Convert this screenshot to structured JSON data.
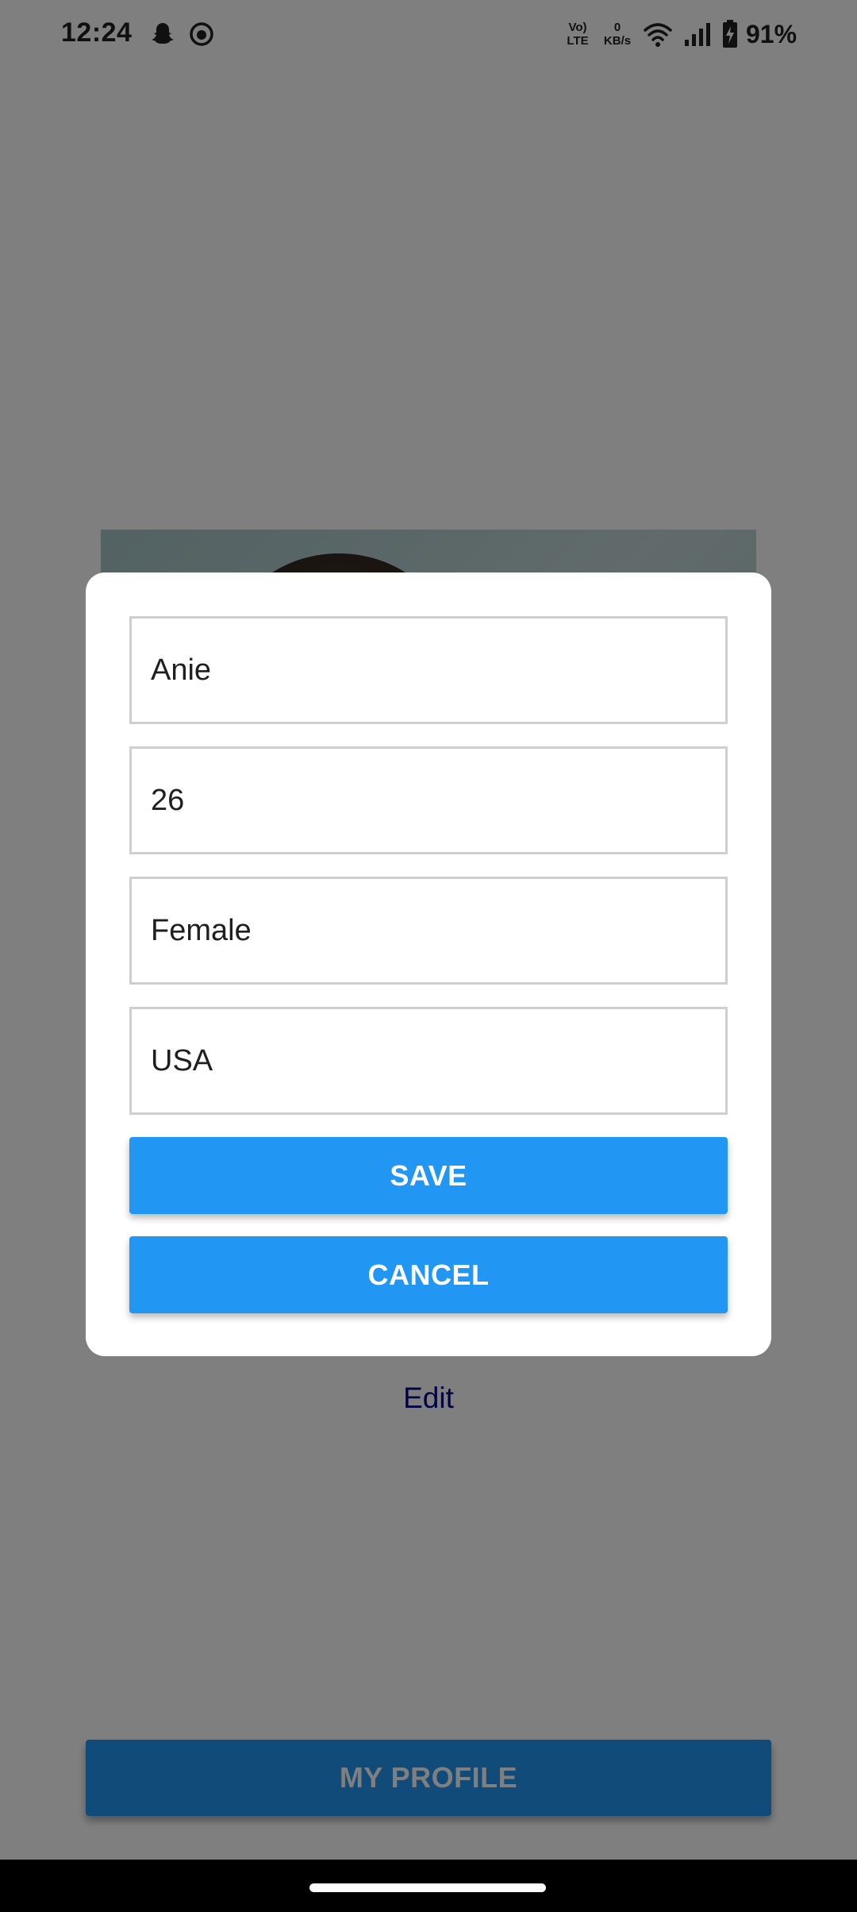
{
  "status_bar": {
    "time": "12:24",
    "volte_top": "Vo)",
    "volte_bottom": "LTE",
    "speed_top": "0",
    "speed_bottom": "KB/s",
    "battery": "91%",
    "icons": [
      "snapchat-icon",
      "notification-app-icon",
      "wifi-icon",
      "signal-icon",
      "battery-charging-icon"
    ]
  },
  "screen": {
    "edit_link": "Edit",
    "my_profile_button": "MY PROFILE"
  },
  "dialog": {
    "fields": {
      "name": "Anie",
      "age": "26",
      "gender": "Female",
      "country": "USA"
    },
    "save_label": "SAVE",
    "cancel_label": "CANCEL"
  },
  "colors": {
    "button_blue": "#2196f3",
    "link_blue": "#00008b",
    "scrim": "rgba(0,0,0,0.5)"
  }
}
